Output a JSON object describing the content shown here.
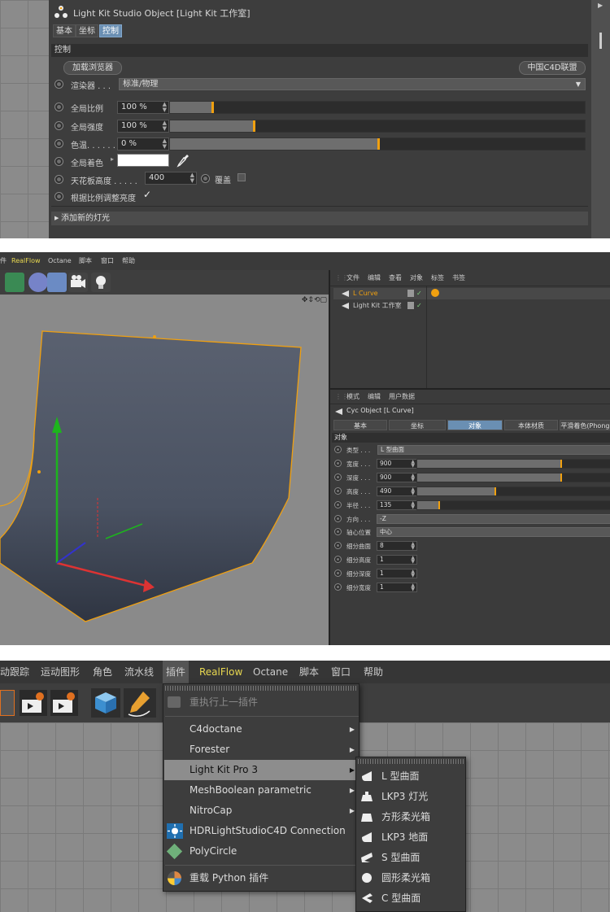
{
  "panel1": {
    "title": "Light Kit Studio Object [Light Kit 工作室]",
    "tabs": [
      "基本",
      "坐标",
      "控制"
    ],
    "active_tab": "控制",
    "section_title": "控制",
    "load_browser_button": "加载浏览器",
    "forum_button": "中国C4D联盟",
    "renderer_label": "渲染器 . . .",
    "renderer_value": "标准/物理",
    "global_scale_label": "全局比例",
    "global_scale_value": "100 %",
    "global_scale_level": 0.1,
    "global_intensity_label": "全局强度",
    "global_intensity_value": "100 %",
    "global_intensity_level": 0.2,
    "color_temp_label": "色温. . . . . .",
    "color_temp_value": "0 %",
    "color_temp_level": 0.5,
    "global_tint_label": "全局着色",
    "global_tint_color": "#ffffff",
    "ceiling_height_label": "天花板高度 . . . . .",
    "ceiling_height_value": "400",
    "override_label": "覆盖",
    "auto_brightness_label": "根据比例调整亮度",
    "auto_brightness_check": "✓",
    "add_light_label": "添加新的灯光"
  },
  "panel2": {
    "menu_items": [
      "件",
      "RealFlow",
      "Octane",
      "脚本",
      "窗口",
      "帮助"
    ],
    "objman_menu": [
      "文件",
      "编辑",
      "查看",
      "对象",
      "标签",
      "书签"
    ],
    "objects": [
      {
        "name": "L Curve",
        "active": true
      },
      {
        "name": "Light Kit 工作室",
        "active": false
      }
    ],
    "attr_menu": [
      "模式",
      "编辑",
      "用户数据"
    ],
    "attr_title": "Cyc Object [L Curve]",
    "tabs": [
      "基本",
      "坐标",
      "对象",
      "本体材质",
      "平滑着色(Phong)"
    ],
    "active_tab": "对象",
    "section": "对象",
    "type_label": "类型 . . .",
    "type_value": "L 型曲面",
    "width_label": "宽度 . . .",
    "width_value": "900",
    "width_level": 0.74,
    "depth_label": "深度 . . .",
    "depth_value": "900",
    "depth_level": 0.74,
    "height_label": "高度 . . .",
    "height_value": "490",
    "height_level": 0.4,
    "radius_label": "半径 . . .",
    "radius_value": "135",
    "radius_level": 0.11,
    "direction_label": "方向 . . .",
    "direction_value": "-Z",
    "axis_label": "轴心位置",
    "axis_value": "中心",
    "seg_curve_label": "细分曲面",
    "seg_curve_value": "8",
    "seg_height_label": "细分高度",
    "seg_height_value": "1",
    "seg_depth_label": "细分深度",
    "seg_depth_value": "1",
    "seg_width_label": "细分宽度",
    "seg_width_value": "1"
  },
  "panel3": {
    "menu_items": [
      "动跟踪",
      "运动图形",
      "角色",
      "流水线",
      "插件",
      "RealFlow",
      "Octane",
      "脚本",
      "窗口",
      "帮助"
    ],
    "active_menu": "插件",
    "plugin_menu": {
      "repeat_last": "重执行上一插件",
      "items": [
        "C4doctane",
        "Forester",
        "Light Kit Pro 3",
        "MeshBoolean parametric",
        "NitroCap",
        "HDRLightStudioC4D Connection",
        "PolyCircle"
      ],
      "highlighted": "Light Kit Pro 3",
      "reload": "重载 Python 插件"
    },
    "submenu": [
      "L 型曲面",
      "LKP3 灯光",
      "方形柔光箱",
      "LKP3 地面",
      "S 型曲面",
      "圆形柔光箱",
      "C 型曲面"
    ]
  },
  "colors": {
    "accent": "#f0a010",
    "tab_active": "#6a8fb3",
    "realflow_yellow": "#e8d850",
    "highlight": "#8d8d8d"
  }
}
